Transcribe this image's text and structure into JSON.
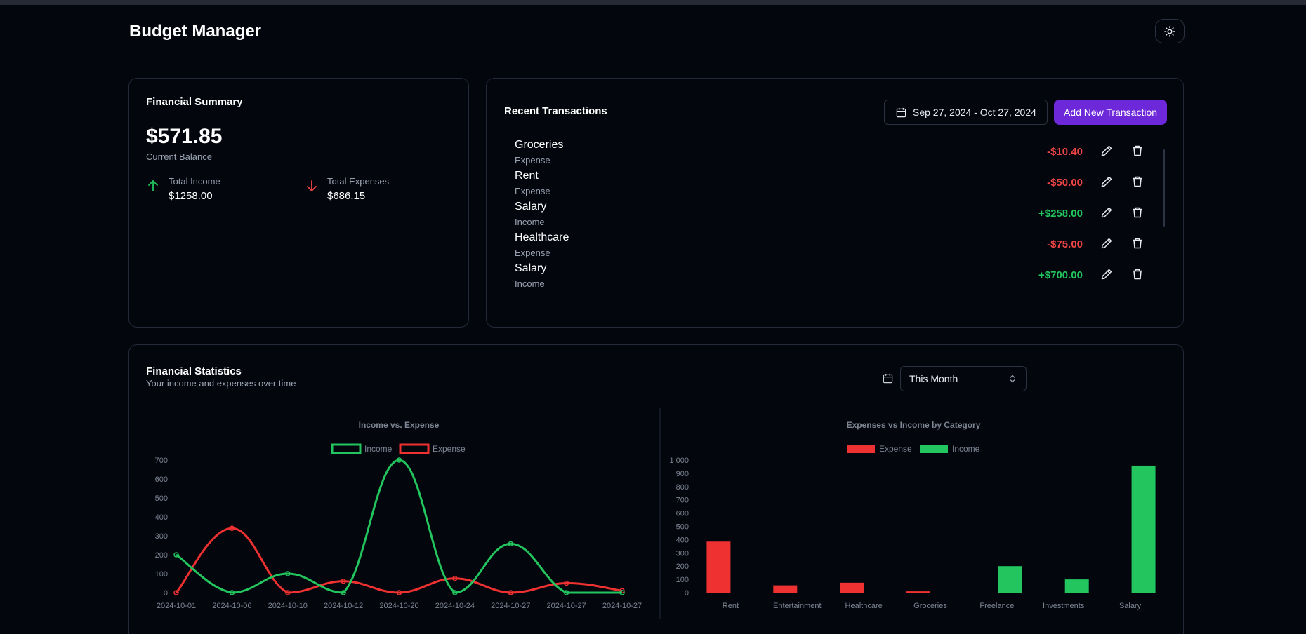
{
  "app": {
    "title": "Budget Manager",
    "theme_icon": "sun-icon"
  },
  "summary": {
    "title": "Financial Summary",
    "balance": "$571.85",
    "balance_label": "Current Balance",
    "income_label": "Total Income",
    "income_value": "$1258.00",
    "expenses_label": "Total Expenses",
    "expenses_value": "$686.15"
  },
  "transactions": {
    "title": "Recent Transactions",
    "date_range": "Sep 27, 2024 - Oct 27, 2024",
    "add_label": "Add New Transaction",
    "items": [
      {
        "category": "Groceries",
        "type": "Expense",
        "amount": "-$10.40"
      },
      {
        "category": "Rent",
        "type": "Expense",
        "amount": "-$50.00"
      },
      {
        "category": "Salary",
        "type": "Income",
        "amount": "+$258.00"
      },
      {
        "category": "Healthcare",
        "type": "Expense",
        "amount": "-$75.00"
      },
      {
        "category": "Salary",
        "type": "Income",
        "amount": "+$700.00"
      }
    ]
  },
  "stats": {
    "title": "Financial Statistics",
    "subtitle": "Your income and expenses over time",
    "period": "This Month"
  },
  "colors": {
    "income": "#22c55e",
    "expense": "#ef3131",
    "accent": "#6d28d9"
  },
  "chart_data": [
    {
      "type": "line",
      "title": "Income vs. Expense",
      "x": [
        "2024-10-01",
        "2024-10-06",
        "2024-10-10",
        "2024-10-12",
        "2024-10-20",
        "2024-10-24",
        "2024-10-27",
        "2024-10-27",
        "2024-10-27"
      ],
      "series": [
        {
          "name": "Income",
          "values": [
            200,
            0,
            100,
            0,
            700,
            0,
            258,
            0,
            0
          ]
        },
        {
          "name": "Expense",
          "values": [
            0,
            340,
            0,
            60,
            0,
            75,
            0,
            50,
            10
          ]
        }
      ],
      "yticks": [
        0,
        100,
        200,
        300,
        400,
        500,
        600,
        700
      ],
      "ylim": [
        0,
        700
      ],
      "legend": "top"
    },
    {
      "type": "bar",
      "title": "Expenses vs Income by Category",
      "categories": [
        "Rent",
        "Entertainment",
        "Healthcare",
        "Groceries",
        "Freelance",
        "Investments",
        "Salary"
      ],
      "series": [
        {
          "name": "Expense",
          "values": [
            385,
            55,
            75,
            10,
            0,
            0,
            0
          ]
        },
        {
          "name": "Income",
          "values": [
            0,
            0,
            0,
            0,
            200,
            100,
            958
          ]
        }
      ],
      "yticks": [
        "0",
        "100",
        "200",
        "300",
        "400",
        "500",
        "600",
        "700",
        "800",
        "900",
        "1 000"
      ],
      "ylim": [
        0,
        1000
      ],
      "legend": "top"
    }
  ]
}
